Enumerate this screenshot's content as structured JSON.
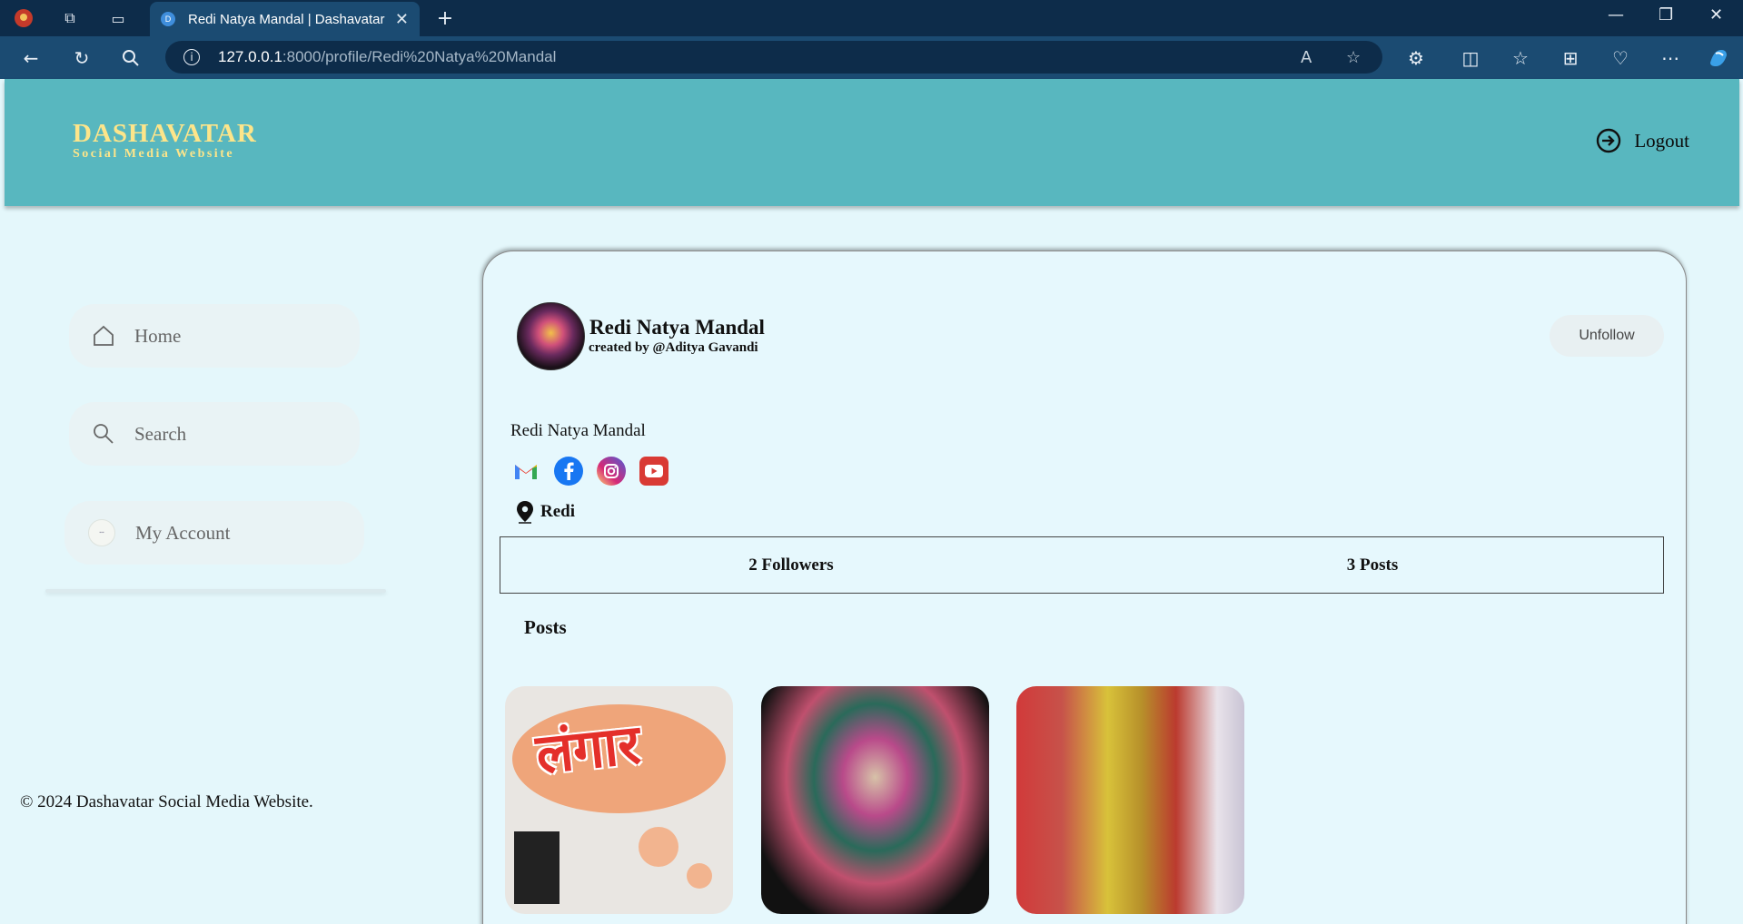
{
  "browser": {
    "tab_title": "Redi Natya Mandal | Dashavatar",
    "tab_favicon": "D",
    "url_host": "127.0.0.1",
    "url_path": ":8000/profile/Redi%20Natya%20Mandal"
  },
  "header": {
    "brand_name": "DASHAVATAR",
    "brand_sub": "Social Media Website",
    "logout_label": "Logout"
  },
  "sidebar": {
    "items": [
      {
        "label": "Home",
        "icon": "home-icon"
      },
      {
        "label": "Search",
        "icon": "search-icon"
      },
      {
        "label": "My Account",
        "icon": "account-avatar"
      }
    ]
  },
  "footer": {
    "text": "© 2024 Dashavatar Social Media Website."
  },
  "profile": {
    "name": "Redi Natya Mandal",
    "created_by": "created by @Aditya Gavandi",
    "unfollow_label": "Unfollow",
    "bio": "Redi Natya Mandal",
    "location": "Redi",
    "socials": [
      "gmail-icon",
      "facebook-icon",
      "instagram-icon",
      "youtube-icon"
    ],
    "followers": "2 Followers",
    "posts_count": "3 Posts",
    "posts_heading": "Posts",
    "post1_text": "लंगार"
  },
  "colors": {
    "header_bg": "#58b7bf",
    "brand": "#fde58a",
    "page_bg": "#e4f7fb"
  }
}
